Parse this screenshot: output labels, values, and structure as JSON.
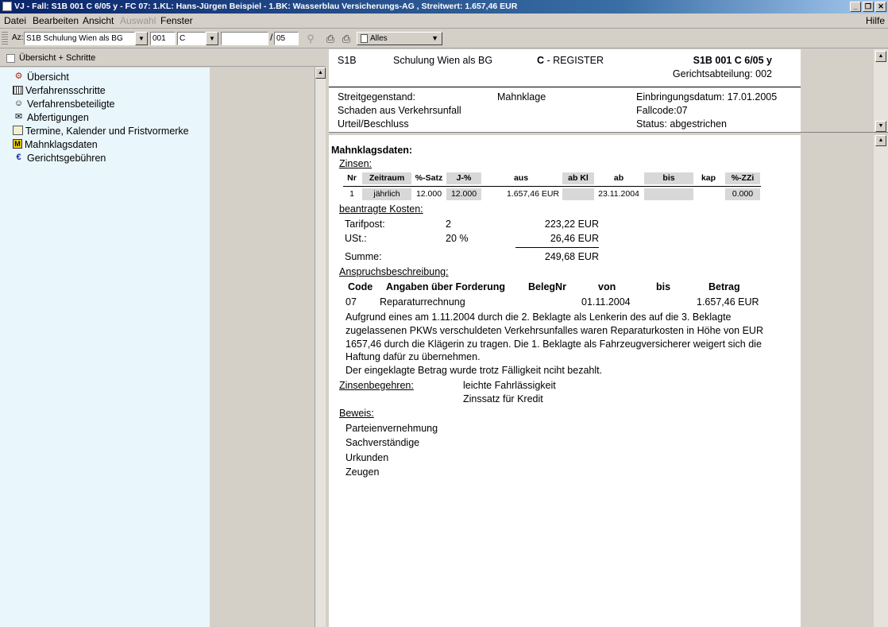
{
  "window": {
    "title": "VJ - Fall: S1B 001 C 6/05 y - FC 07: 1.KL: Hans-Jürgen Beispiel - 1.BK: Wasserblau Versicherungs-AG , Streitwert: 1.657,46 EUR",
    "buttons": [
      "_",
      "❐",
      "✕"
    ]
  },
  "menu": {
    "datei": "Datei",
    "bearbeiten": "Bearbeiten",
    "ansicht": "Ansicht",
    "auswahl": "Auswahl",
    "fenster": "Fenster",
    "hilfe": "Hilfe"
  },
  "toolbar": {
    "az_label": "Az:",
    "court_value": "S1B Schulung Wien als BG",
    "nr_value": "001",
    "type_value": "C",
    "number_value": "",
    "slash": "/",
    "year_value": "05",
    "filter_value": "Alles"
  },
  "left": {
    "header_label": "Übersicht + Schritte",
    "items": [
      {
        "label": "Übersicht",
        "icon": "overview-icon"
      },
      {
        "label": "Verfahrensschritte",
        "icon": "table-icon"
      },
      {
        "label": "Verfahrensbeteiligte",
        "icon": "people-icon"
      },
      {
        "label": "Abfertigungen",
        "icon": "envelope-icon"
      },
      {
        "label": "Termine, Kalender und Fristvormerke",
        "icon": "calendar-icon"
      },
      {
        "label": "Mahnklagsdaten",
        "icon": "m-icon"
      },
      {
        "label": "Gerichtsgebühren",
        "icon": "euro-icon"
      }
    ]
  },
  "header": {
    "court_code": "S1B",
    "court_name": "Schulung Wien als BG",
    "register_letter": "C",
    "register_text": " - REGISTER",
    "case_number": "S1B 001 C 6/05 y",
    "department": "Gerichtsabteilung: 002",
    "subject_label": "Streitgegenstand:",
    "subject_value": "Schaden aus Verkehrsunfall",
    "type": "Mahnklage",
    "filing_date": "Einbringungsdatum: 17.01.2005",
    "fallcode": "Fallcode:07",
    "judgment": "Urteil/Beschluss",
    "status": "Status: abgestrichen"
  },
  "body": {
    "heading": "Mahnklagsdaten:",
    "zinsen_label": "Zinsen:",
    "zinsen_headers": [
      "Nr",
      "Zeitraum",
      "%-Satz",
      "J-%",
      "aus",
      "ab Kl",
      "ab",
      "bis",
      "kap",
      "%-ZZi"
    ],
    "zinsen_row": [
      "1",
      "jährlich",
      "12.000",
      "12.000",
      "1.657,46 EUR",
      "",
      "23.11.2004",
      "",
      "",
      "0.000"
    ],
    "kosten_label": "beantragte Kosten:",
    "tarifpost_label": "Tarifpost:",
    "tarifpost_nr": "2",
    "tarifpost_value": "223,22 EUR",
    "ust_label": "USt.:",
    "ust_rate": "20 %",
    "ust_value": "26,46 EUR",
    "summe_label": "Summe:",
    "summe_value": "249,68 EUR",
    "anspruch_label": "Anspruchsbeschreibung:",
    "anspruch_headers": [
      "Code",
      "Angaben über Forderung",
      "BelegNr",
      "von",
      "bis",
      "Betrag"
    ],
    "anspruch_row": [
      "07",
      "Reparaturrechnung",
      "",
      "01.11.2004",
      "",
      "1.657,46 EUR"
    ],
    "description": [
      "Aufgrund eines am 1.11.2004 durch die 2. Beklagte als Lenkerin des auf die 3. Beklagte",
      "zugelassenen PKWs verschuldeten Verkehrsunfalles waren Reparaturkosten in Höhe von EUR",
      "1657,46 durch die Klägerin zu tragen. Die 1. Beklagte als Fahrzeugversicherer weigert sich die",
      "Haftung dafür zu übernehmen.",
      "Der eingeklagte Betrag wurde trotz Fälligkeit nciht bezahlt."
    ],
    "zinsenbegehren_label": "Zinsenbegehren:",
    "zinsenbegehren_values": [
      "leichte Fahrlässigkeit",
      "Zinssatz für Kredit"
    ],
    "beweis_label": "Beweis:",
    "beweis_items": [
      "Parteienvernehmung",
      "Sachverständige",
      "Urkunden",
      "Zeugen"
    ]
  }
}
